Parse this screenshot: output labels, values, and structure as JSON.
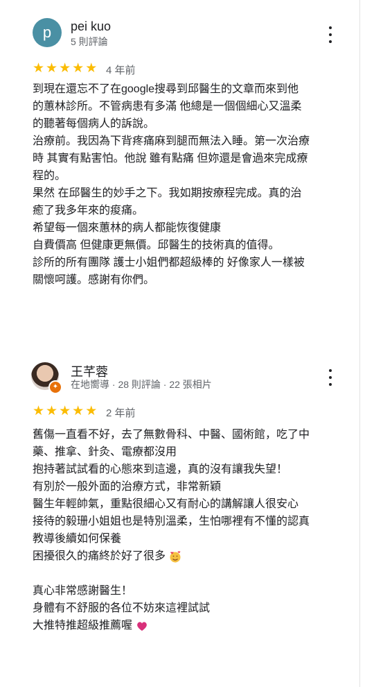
{
  "reviews": [
    {
      "avatar_letter": "p",
      "avatar_color": "#4a90a4",
      "name": "pei kuo",
      "meta": "5 則評論",
      "stars": 5,
      "age": "4 年前",
      "lines": [
        "到現在還忘不了在google搜尋到邱醫生的文章而來到他",
        "的蕙林診所。不管病患有多滿 他總是一個個細心又溫柔",
        "的聽著每個病人的訴說。",
        "治療前。我因為下背疼痛麻到腿而無法入睡。第一次治療",
        "時 其實有點害怕。他說 雖有點痛 但妳還是會過來完成療",
        "程的。",
        "果然 在邱醫生的妙手之下。我如期按療程完成。真的治",
        "癒了我多年來的痠痛。",
        "希望每一個來蕙林的病人都能恢復健康",
        "自費價高 但健康更無價。邱醫生的技術真的值得。",
        "診所的所有團隊  護士小姐們都超級棒的 好像家人一樣被",
        "關懷呵護。感謝有你們。"
      ]
    },
    {
      "name": "王芊蓉",
      "meta": "在地嚮導 · 28 則評論 · 22 張相片",
      "stars": 5,
      "age": "2 年前",
      "lines": [
        "舊傷一直看不好，去了無數骨科、中醫、國術館，吃了中",
        "藥、推拿、針灸、電療都沒用",
        "抱持著試試看的心態來到這邊，真的沒有讓我失望！",
        "有別於一般外面的治療方式，非常新穎",
        "醫生年輕帥氣，重點很細心又有耐心的講解讓人很安心",
        "接待的毅珊小姐姐也是特別溫柔，生怕哪裡有不懂的認真",
        "教導後續如何保養",
        "困擾很久的痛終於好了很多",
        "",
        "真心非常感謝醫生！",
        "身體有不舒服的各位不妨來這裡試試",
        "大推特推超級推薦喔"
      ]
    }
  ],
  "colors": {
    "star": "#fbbc04",
    "guide_badge": "#e8710a",
    "secondary_text": "#5f6368"
  },
  "icons": {
    "more": "more-vert-icon",
    "star": "star-icon",
    "guide": "local-guide-badge-icon"
  }
}
